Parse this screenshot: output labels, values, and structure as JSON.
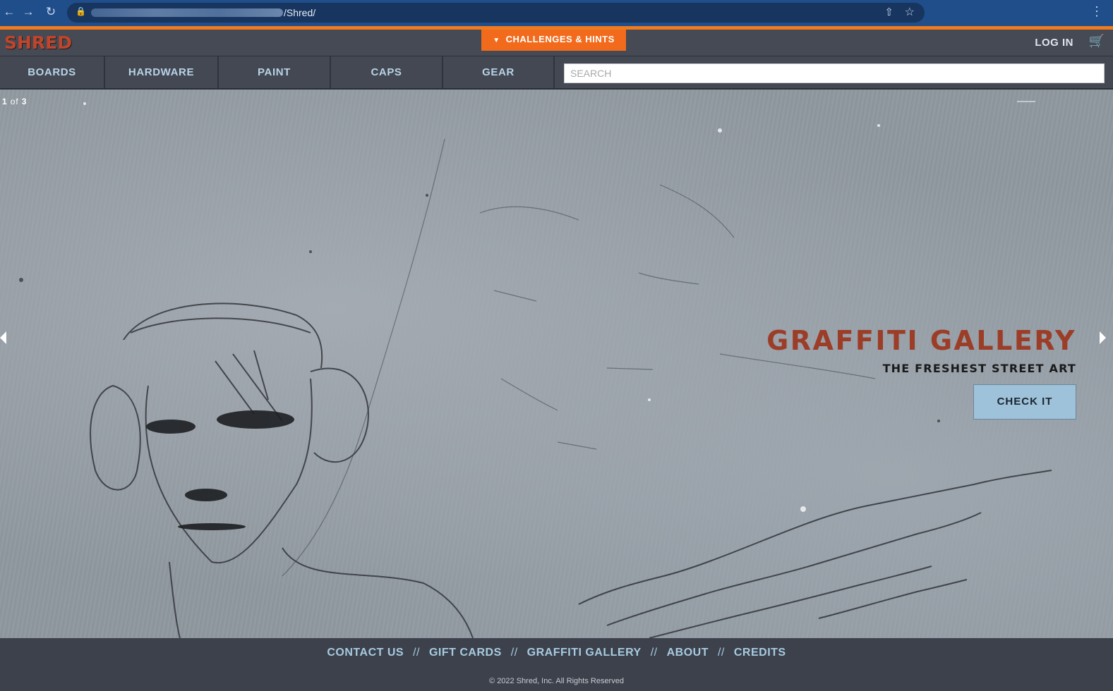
{
  "browser": {
    "url_path": "/Shred/",
    "back_icon": "arrow-left-icon",
    "forward_icon": "arrow-right-icon",
    "reload_icon": "reload-icon",
    "lock_icon": "lock-icon",
    "share_icon": "share-icon",
    "bookmark_icon": "star-icon",
    "menu_icon": "kebab-menu-icon"
  },
  "header": {
    "logo": "SHRED",
    "challenges_label": "CHALLENGES & HINTS",
    "login_label": "LOG IN",
    "cart_icon": "cart-icon"
  },
  "categories": [
    {
      "label": "BOARDS"
    },
    {
      "label": "HARDWARE"
    },
    {
      "label": "PAINT"
    },
    {
      "label": "CAPS"
    },
    {
      "label": "GEAR"
    }
  ],
  "search": {
    "placeholder": "SEARCH"
  },
  "hero": {
    "slide_current": "1",
    "slide_of": "of",
    "slide_total": "3",
    "title": "GRAFFITI GALLERY",
    "subtitle": "THE FRESHEST STREET ART",
    "cta_label": "CHECK IT"
  },
  "footer": {
    "links": [
      {
        "label": "CONTACT US"
      },
      {
        "label": "GIFT CARDS"
      },
      {
        "label": "GRAFFITI GALLERY"
      },
      {
        "label": "ABOUT"
      },
      {
        "label": "CREDITS"
      }
    ],
    "separator": "//",
    "copyright": "© 2022 Shred, Inc. All Rights Reserved"
  },
  "colors": {
    "accent_orange": "#f26b1d",
    "logo_red": "#c0452a",
    "title_red": "#9c3d27",
    "nav_text": "#b8d3e6",
    "cta_bg": "#9ec2d9"
  }
}
